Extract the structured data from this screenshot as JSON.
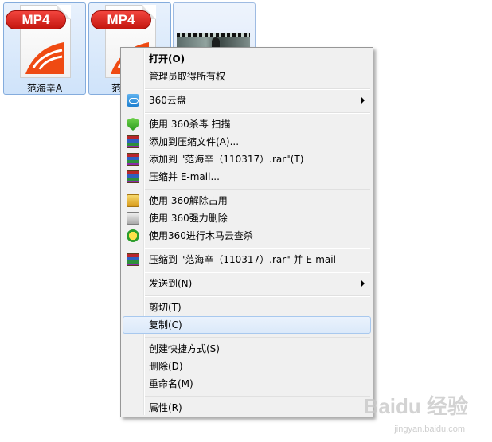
{
  "files": [
    {
      "badge": "MP4",
      "name": "范海辛A"
    },
    {
      "badge": "MP4",
      "name": "范"
    },
    {
      "type": "video"
    }
  ],
  "menu": {
    "items": {
      "open": "打开(O)",
      "take_ownership": "管理员取得所有权",
      "cloud360": "360云盘",
      "scan360": "使用 360杀毒 扫描",
      "add_archive": "添加到压缩文件(A)...",
      "add_rar": "添加到 \"范海辛（110317）.rar\"(T)",
      "compress_email": "压缩并 E-mail...",
      "unlock360": "使用 360解除占用",
      "shred360": "使用 360强力删除",
      "trojan360": "使用360进行木马云查杀",
      "compress_rar_email": "压缩到 \"范海辛（110317）.rar\" 并 E-mail",
      "send_to": "发送到(N)",
      "cut": "剪切(T)",
      "copy": "复制(C)",
      "create_shortcut": "创建快捷方式(S)",
      "delete": "删除(D)",
      "rename": "重命名(M)",
      "properties": "属性(R)"
    },
    "highlighted": "copy"
  },
  "watermark": {
    "brand": "Baidu 经验",
    "url": "jingyan.baidu.com"
  },
  "colors": {
    "badge_red": "#d8231c",
    "highlight_border": "#a8c8ee",
    "menu_bg": "#f0f0f0"
  }
}
